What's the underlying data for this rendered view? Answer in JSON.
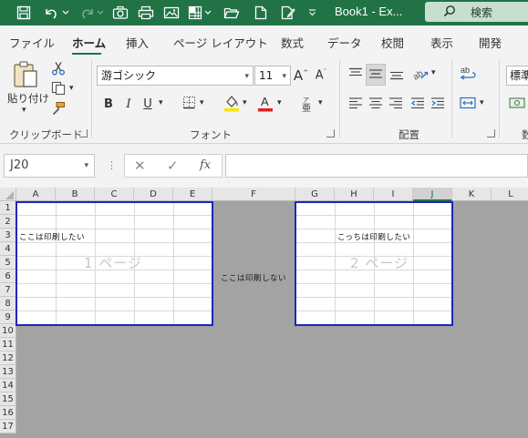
{
  "titlebar": {
    "title": "Book1  -  Ex...",
    "search_label": "検索",
    "bg_color": "#217346"
  },
  "tabs": [
    "ファイル",
    "ホーム",
    "挿入",
    "ページ レイアウト",
    "数式",
    "データ",
    "校閲",
    "表示",
    "開発"
  ],
  "active_tab": "ホーム",
  "ribbon": {
    "clipboard": {
      "paste_label": "貼り付け",
      "group_label": "クリップボード"
    },
    "font": {
      "font_name": "游ゴシック",
      "font_size": "11",
      "group_label": "フォント"
    },
    "alignment": {
      "group_label": "配置"
    },
    "number": {
      "format": "標準",
      "group_label_partial": "数"
    }
  },
  "formula_bar": {
    "name_box": "J20",
    "formula": "",
    "fx_label": "fx"
  },
  "sheet": {
    "columns": [
      "A",
      "B",
      "C",
      "D",
      "E",
      "F",
      "G",
      "H",
      "I",
      "J",
      "K",
      "L"
    ],
    "selected_column": "J",
    "rows": [
      "1",
      "2",
      "3",
      "4",
      "5",
      "6",
      "7",
      "8",
      "9",
      "10",
      "11",
      "12",
      "13",
      "14",
      "15",
      "16",
      "17"
    ],
    "cells": {
      "A3": "ここは印刷したい",
      "F6": "ここは印刷しない",
      "H3": "こっちは印刷したい"
    },
    "page1_label": "1 ページ",
    "page2_label": "2 ページ",
    "page_break_color": "#1f27b8"
  }
}
